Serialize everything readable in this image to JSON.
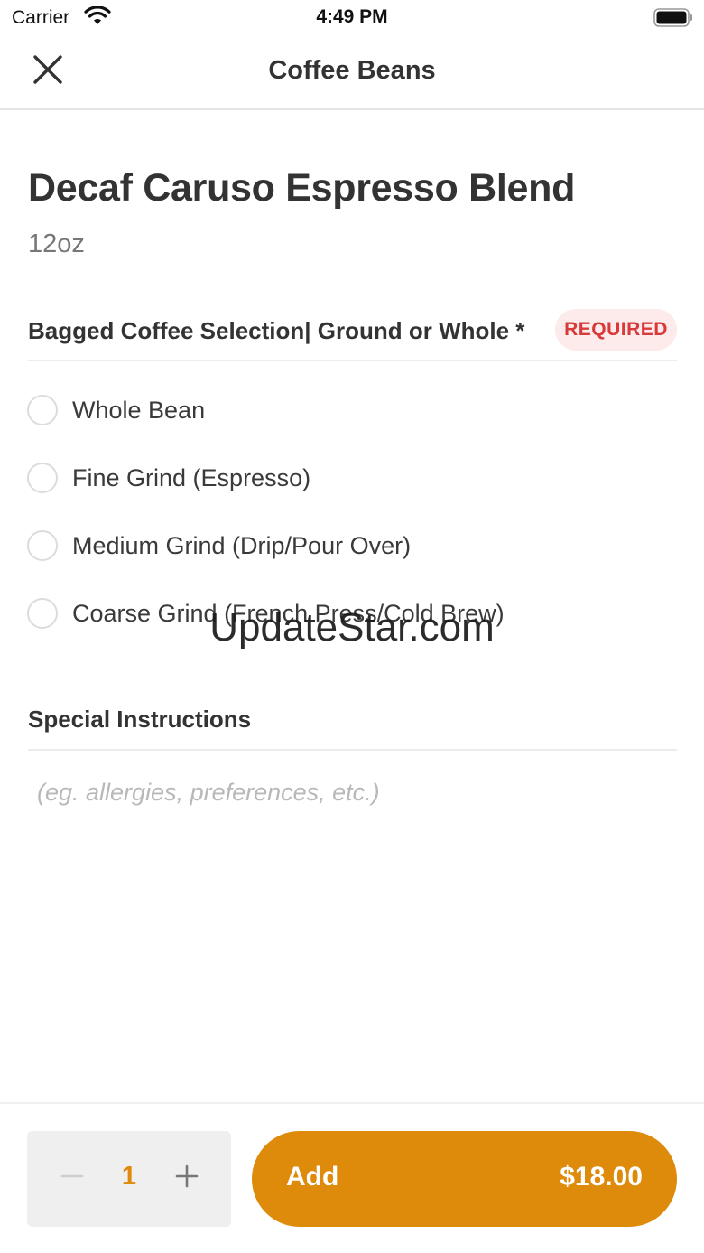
{
  "status_bar": {
    "carrier": "Carrier",
    "time": "4:49 PM"
  },
  "nav": {
    "title": "Coffee Beans",
    "close_icon": "close-icon"
  },
  "product": {
    "name": "Decaf Caruso Espresso Blend",
    "size": "12oz"
  },
  "option_group": {
    "title": "Bagged Coffee Selection| Ground or Whole *",
    "badge": "REQUIRED",
    "options": [
      {
        "label": "Whole Bean",
        "selected": false
      },
      {
        "label": "Fine Grind (Espresso)",
        "selected": false
      },
      {
        "label": "Medium Grind (Drip/Pour Over)",
        "selected": false
      },
      {
        "label": "Coarse Grind (French Press/Cold Brew)",
        "selected": false
      }
    ]
  },
  "watermark": "UpdateStar.com",
  "special_instructions": {
    "title": "Special Instructions",
    "placeholder": "(eg. allergies, preferences, etc.)",
    "value": ""
  },
  "footer": {
    "quantity": "1",
    "add_label": "Add",
    "price": "$18.00"
  },
  "colors": {
    "accent": "#de8a0b",
    "required_text": "#d83a3a",
    "required_bg": "#fdeaea",
    "stepper_bg": "#efefef"
  }
}
